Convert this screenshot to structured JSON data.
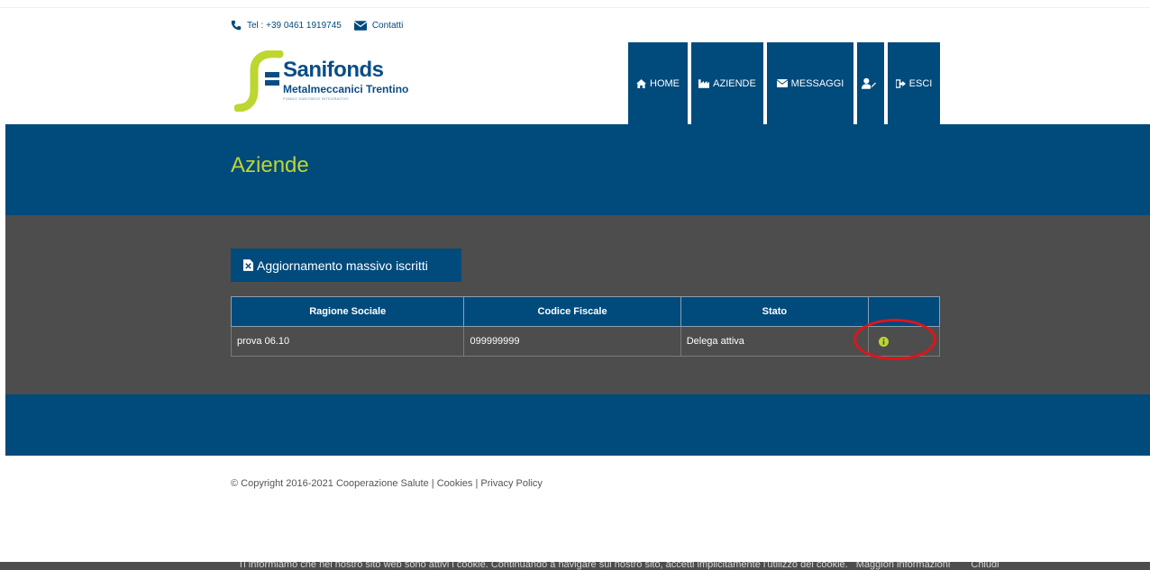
{
  "contact": {
    "phone": "Tel : +39 0461 1919745",
    "contacts_label": "Contatti"
  },
  "logo": {
    "title": "Sanifonds",
    "subtitle": "Metalmeccanici Trentino",
    "tagline": "FONDO SANITARIO INTEGRATIVO"
  },
  "nav": {
    "home": "HOME",
    "aziende": "AZIENDE",
    "messaggi": "MESSAGGI",
    "user_icon": "user-edit-icon",
    "esci": "ESCI"
  },
  "page": {
    "title": "Aziende"
  },
  "actions": {
    "mass_update": "Aggiornamento massivo iscritti"
  },
  "table": {
    "headers": [
      "Ragione Sociale",
      "Codice Fiscale",
      "Stato",
      ""
    ],
    "rows": [
      {
        "ragione_sociale": "prova 06.10",
        "codice_fiscale": "099999999",
        "stato": "Delega attiva",
        "action_icon": "info-icon"
      }
    ]
  },
  "footer": {
    "copyright": "© Copyright 2016-2021 Cooperazione Salute",
    "sep1": " | ",
    "cookies": "Cookies",
    "sep2": " | ",
    "privacy": "Privacy Policy"
  },
  "cookie_bar": {
    "text": "Ti informiamo che nel nostro sito web sono attivi i cookie. Continuando a navigare sul nostro sito, accetti implicitamente l'utilizzo dei cookie.",
    "more_info": "Maggiori informazioni",
    "close": "Chiudi"
  },
  "colors": {
    "brand_blue": "#004a7c",
    "accent_green": "#bed630",
    "content_grey": "#4d4d4d",
    "highlight_red": "#e0141b"
  }
}
